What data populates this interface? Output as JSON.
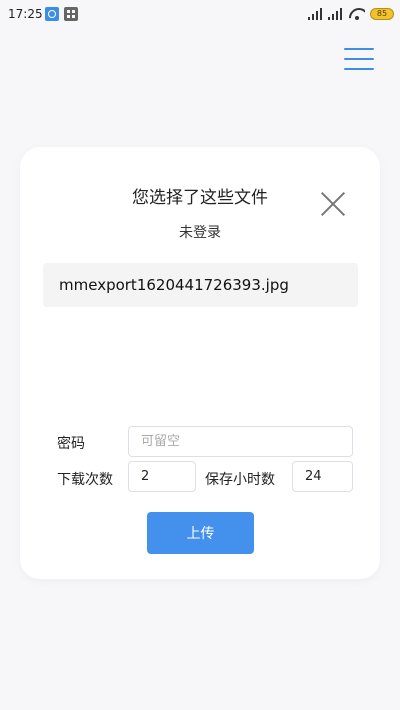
{
  "status_bar": {
    "time": "17:25",
    "battery": "85"
  },
  "dialog": {
    "title": "您选择了这些文件",
    "login_status": "未登录",
    "files": [
      "mmexport1620441726393.jpg"
    ],
    "password": {
      "label": "密码",
      "value": "",
      "placeholder": "可留空"
    },
    "download_count": {
      "label": "下载次数",
      "value": "2"
    },
    "retention_hours": {
      "label": "保存小时数",
      "value": "24"
    },
    "upload_label": "上传"
  },
  "colors": {
    "accent": "#4391ed",
    "menu": "#3d8ee6"
  }
}
